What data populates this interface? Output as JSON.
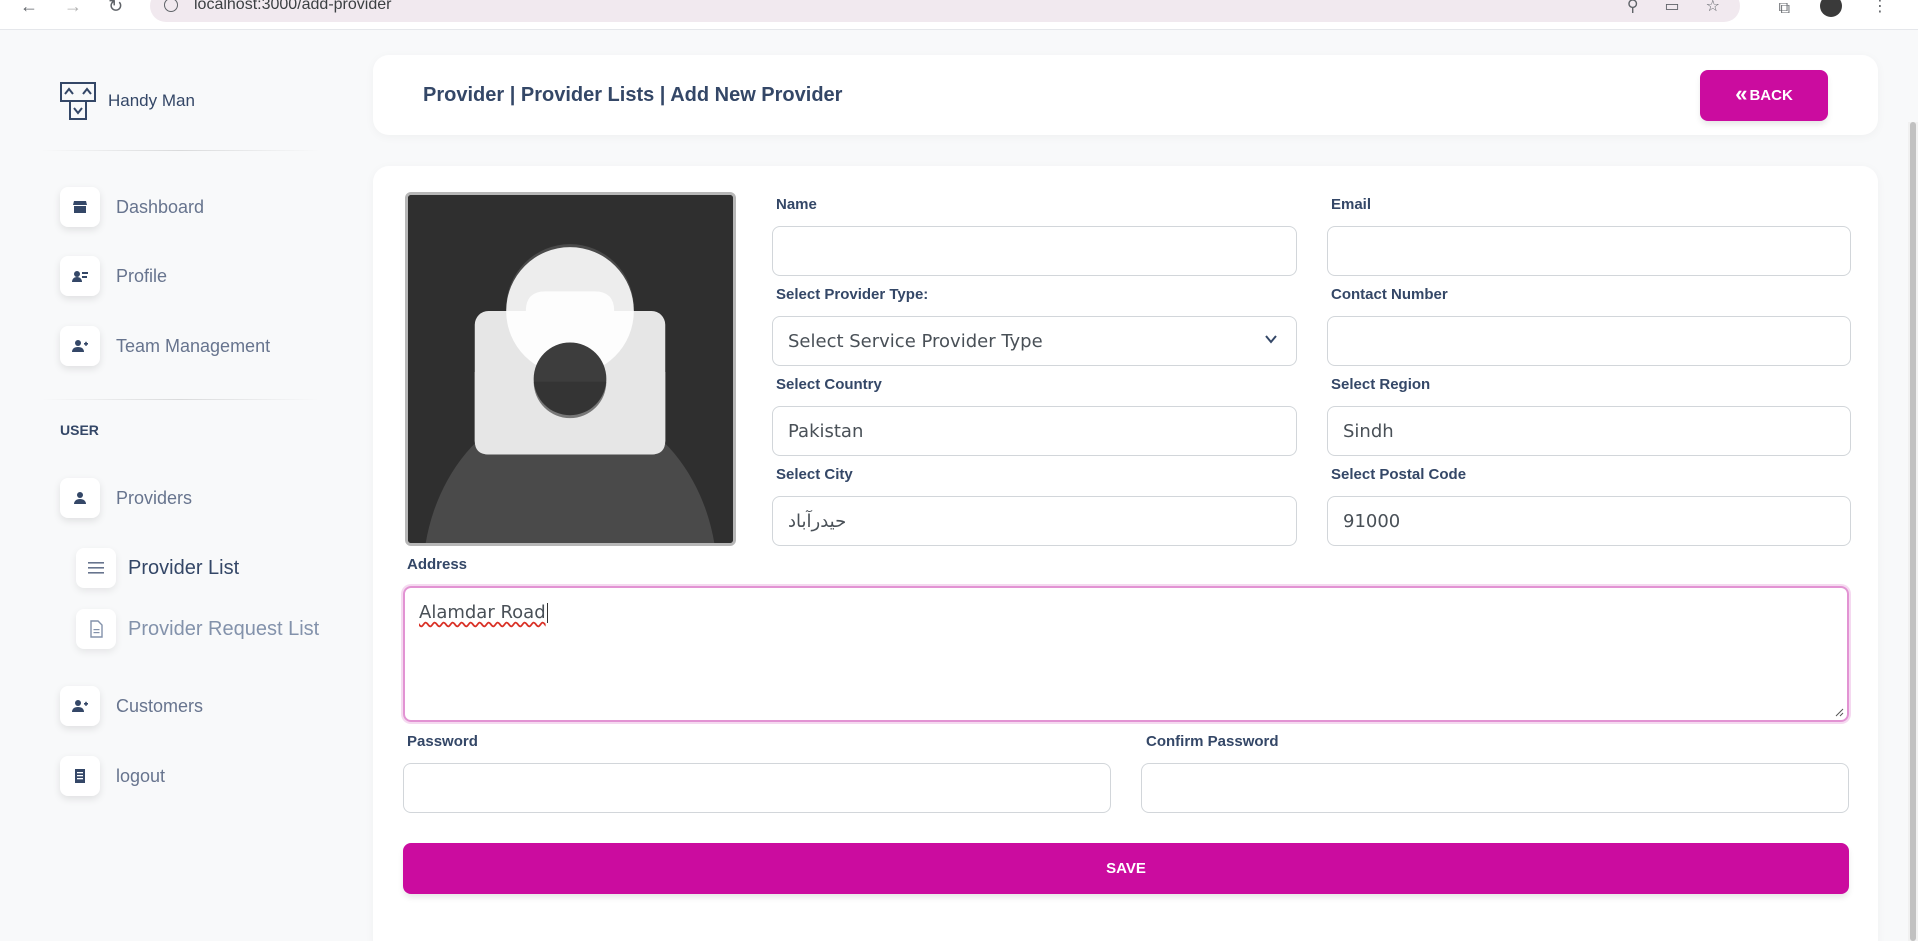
{
  "browser": {
    "url": "localhost:3000/add-provider"
  },
  "sidebar": {
    "brand": "Handy Man",
    "section_user": "USER",
    "items": [
      {
        "label": "Dashboard"
      },
      {
        "label": "Profile"
      },
      {
        "label": "Team Management"
      },
      {
        "label": "Providers"
      },
      {
        "label": "Customers"
      },
      {
        "label": "logout"
      }
    ],
    "sub_items": [
      {
        "label": "Provider List"
      },
      {
        "label": "Provider Request List"
      }
    ]
  },
  "header": {
    "breadcrumb": "Provider | Provider Lists | Add New Provider",
    "back_label": "BACK"
  },
  "form": {
    "name_label": "Name",
    "name_value": "",
    "email_label": "Email",
    "email_value": "",
    "provider_type_label": "Select Provider Type:",
    "provider_type_value": "Select Service Provider Type",
    "contact_label": "Contact Number",
    "contact_value": "",
    "country_label": "Select Country",
    "country_value": "Pakistan",
    "region_label": "Select Region",
    "region_value": "Sindh",
    "city_label": "Select City",
    "city_value": "حیدرآباد",
    "postal_label": "Select Postal Code",
    "postal_value": "91000",
    "address_label": "Address",
    "address_value": "Alamdar Road",
    "password_label": "Password",
    "confirm_password_label": "Confirm Password",
    "save_label": "SAVE"
  },
  "colors": {
    "accent": "#cb0c9f",
    "text": "#344767",
    "muted": "#67748e",
    "page_bg": "#f8f9fa"
  }
}
